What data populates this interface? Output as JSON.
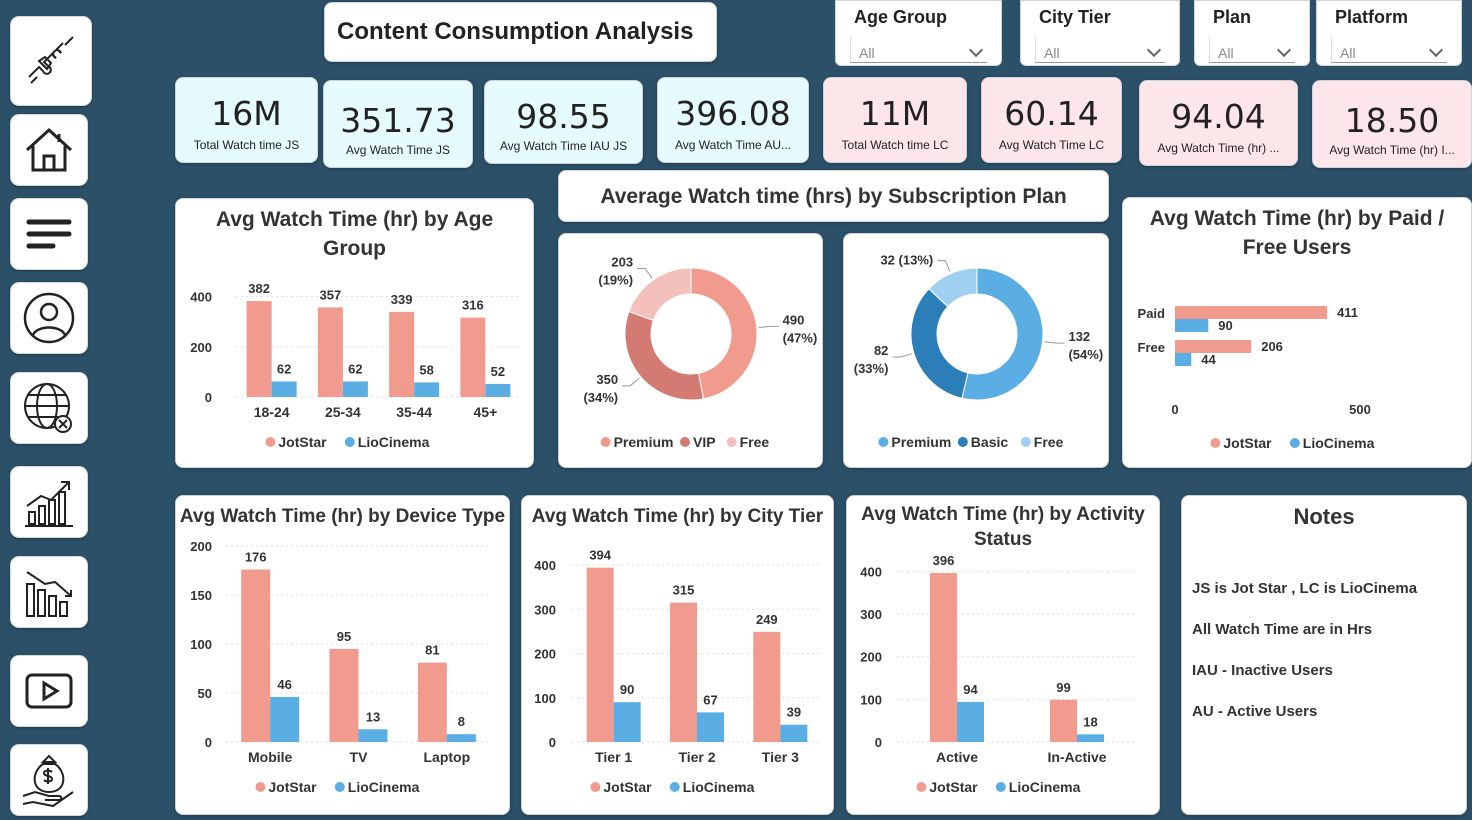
{
  "title": "Content Consumption Analysis",
  "nav": {
    "icons": [
      "puzzle-connect-icon",
      "home-icon",
      "menu-icon",
      "user-profile-icon",
      "globe-icon",
      "growth-chart-icon",
      "decline-chart-icon",
      "play-video-icon",
      "money-bag-icon"
    ]
  },
  "slicers": [
    {
      "label": "Age Group",
      "value": "All"
    },
    {
      "label": "City Tier",
      "value": "All"
    },
    {
      "label": "Plan",
      "value": "All"
    },
    {
      "label": "Platform",
      "value": "All"
    }
  ],
  "kpis": [
    {
      "value": "16M",
      "caption": "Total Watch time JS"
    },
    {
      "value": "351.73",
      "caption": "Avg Watch Time JS"
    },
    {
      "value": "98.55",
      "caption": "Avg Watch Time IAU JS"
    },
    {
      "value": "396.08",
      "caption": "Avg Watch Time AU..."
    },
    {
      "value": "11M",
      "caption": "Total Watch time LC"
    },
    {
      "value": "60.14",
      "caption": "Avg Watch Time LC"
    },
    {
      "value": "94.04",
      "caption": "Avg Watch Time (hr) ..."
    },
    {
      "value": "18.50",
      "caption": "Avg Watch Time (hr) I..."
    }
  ],
  "colors": {
    "jotstar": "#f19b8e",
    "liocinema": "#5aaee3",
    "premium_pink": "#f19b8e",
    "vip": "#d37a73",
    "free_pink": "#f4c0bb",
    "premium_blue": "#5aaee3",
    "basic": "#2b7eb8",
    "free_blue": "#9fd0f2"
  },
  "subscription_header": "Average Watch time (hrs) by Subscription Plan",
  "notes": {
    "title": "Notes",
    "lines": [
      "JS is Jot Star , LC is LioCinema",
      "All Watch Time are in Hrs",
      "IAU - Inactive Users",
      "AU - Active Users"
    ]
  },
  "chart_data": [
    {
      "id": "age",
      "type": "bar",
      "title": "Avg Watch Time (hr) by Age Group",
      "categories": [
        "18-24",
        "25-34",
        "35-44",
        "45+"
      ],
      "series": [
        {
          "name": "JotStar",
          "values": [
            382,
            357,
            339,
            316
          ]
        },
        {
          "name": "LioCinema",
          "values": [
            62,
            62,
            58,
            52
          ]
        }
      ],
      "yticks": [
        0,
        200,
        400
      ],
      "ylim": [
        0,
        450
      ],
      "legend": "bottom"
    },
    {
      "id": "plan_js",
      "type": "pie",
      "slices": [
        {
          "name": "Premium",
          "value": 490,
          "label": "490\n(47%)"
        },
        {
          "name": "VIP",
          "value": 350,
          "label": "350\n(34%)"
        },
        {
          "name": "Free",
          "value": 203,
          "label": "203\n(19%)"
        }
      ],
      "legend": "bottom"
    },
    {
      "id": "plan_lc",
      "type": "pie",
      "slices": [
        {
          "name": "Premium",
          "value": 132,
          "label": "132\n(54%)"
        },
        {
          "name": "Basic",
          "value": 82,
          "label": "82\n(33%)"
        },
        {
          "name": "Free",
          "value": 32,
          "label": "32 (13%)"
        }
      ],
      "legend": "bottom"
    },
    {
      "id": "paid",
      "type": "bar",
      "orientation": "horizontal",
      "title": "Avg Watch Time (hr) by Paid / Free Users",
      "categories": [
        "Paid",
        "Free"
      ],
      "series": [
        {
          "name": "JotStar",
          "values": [
            411,
            206
          ]
        },
        {
          "name": "LioCinema",
          "values": [
            90,
            44
          ]
        }
      ],
      "xticks": [
        0,
        500
      ],
      "xlim": [
        0,
        500
      ],
      "legend": "bottom"
    },
    {
      "id": "device",
      "type": "bar",
      "title": "Avg Watch Time (hr) by Device Type",
      "categories": [
        "Mobile",
        "TV",
        "Laptop"
      ],
      "series": [
        {
          "name": "JotStar",
          "values": [
            176,
            95,
            81
          ]
        },
        {
          "name": "LioCinema",
          "values": [
            46,
            13,
            8
          ]
        }
      ],
      "yticks": [
        0,
        50,
        100,
        150,
        200
      ],
      "ylim": [
        0,
        200
      ],
      "legend": "bottom"
    },
    {
      "id": "city",
      "type": "bar",
      "title": "Avg Watch Time (hr) by City Tier",
      "categories": [
        "Tier 1",
        "Tier 2",
        "Tier 3"
      ],
      "series": [
        {
          "name": "JotStar",
          "values": [
            394,
            315,
            249
          ]
        },
        {
          "name": "LioCinema",
          "values": [
            90,
            67,
            39
          ]
        }
      ],
      "yticks": [
        0,
        100,
        200,
        300,
        400
      ],
      "ylim": [
        0,
        400
      ],
      "legend": "bottom"
    },
    {
      "id": "activity",
      "type": "bar",
      "title": "Avg Watch Time (hr) by Activity Status",
      "categories": [
        "Active",
        "In-Active"
      ],
      "series": [
        {
          "name": "JotStar",
          "values": [
            396,
            99
          ]
        },
        {
          "name": "LioCinema",
          "values": [
            94,
            18
          ]
        }
      ],
      "yticks": [
        0,
        100,
        200,
        300,
        400
      ],
      "ylim": [
        0,
        450
      ],
      "legend": "bottom"
    }
  ]
}
